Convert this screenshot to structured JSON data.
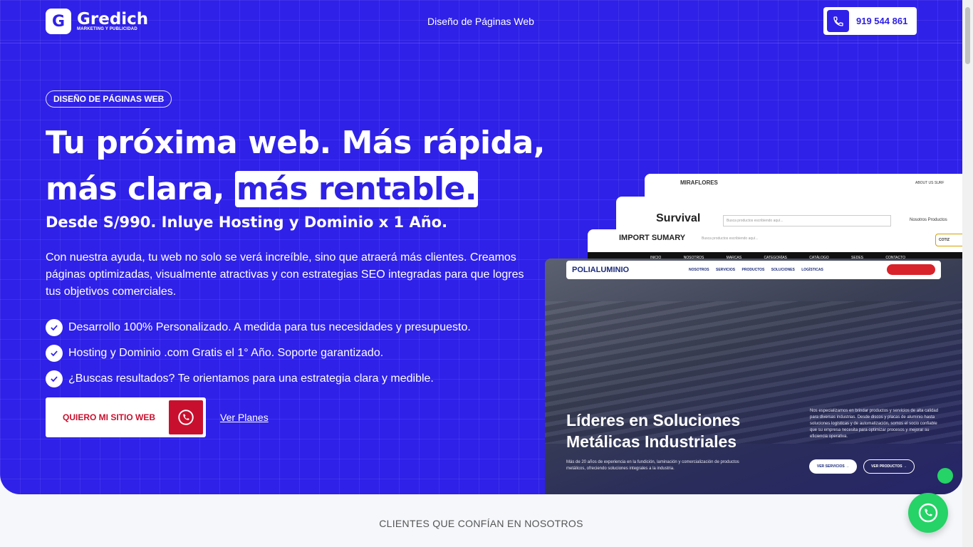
{
  "header": {
    "logo_mark": "G",
    "brand_name": "Gredich",
    "brand_tagline": "MARKETING Y PUBLICIDAD",
    "nav_title": "Diseño de Páginas Web",
    "phone": "919 544 861"
  },
  "hero": {
    "tag": "DISEÑO DE PÁGINAS WEB",
    "headline_part1": "Tu próxima web. Más rápida, más clara, ",
    "headline_highlight": "más rentable.",
    "subheadline": "Desde S/990. Inluye Hosting y Dominio x 1 Año.",
    "description": "Con nuestra ayuda, tu web no solo se verá increíble, sino que atraerá más clientes. Creamos páginas optimizadas, visualmente atractivas y con estrategias SEO integradas para que logres tus objetivos comerciales.",
    "checks": [
      "Desarrollo 100% Personalizado. A medida para tus necesidades y presupuesto.",
      "Hosting y Dominio .com Gratis el 1° Año. Soporte garantizado.",
      "¿Buscas resultados? Te orientamos para una estrategia clara y medible."
    ],
    "cta_label": "QUIERO MI SITIO WEB",
    "secondary_link": "Ver Planes"
  },
  "mockups": {
    "miraflores": {
      "logo": "MIRAFLORES",
      "links": "ABOUT US SURF"
    },
    "survival": {
      "logo": "Survival",
      "search": "Busca productos escribiendo aquí...",
      "links": "Nosotros Productos"
    },
    "import": {
      "logo": "IMPORT SUMARY",
      "search": "Busca productos escribiendo aquí...",
      "button": "COTIZ",
      "menu": "INICIO NOSOTROS MARCAS CATEGORÍAS CATÁLOGO SEDES CONTACTO"
    },
    "polialuminio": {
      "logo": "POLIALUMINIO",
      "links": "NOSOTROS SERVICIOS PRODUCTOS SOLUCIONES LOGÍSTICAS",
      "title_line1": "Líderes en Soluciones",
      "title_line2": "Metálicas Industriales",
      "small_text": "Más de 20 años de experiencia en la fundición, laminación y comercialización de productos metálicos, ofreciendo soluciones integrales a la industria.",
      "right_text": "Nos especializamos en brindar productos y servicios de alta calidad para diversas industrias. Desde discos y placas de aluminio hasta soluciones logísticas y de automatización, somos el socio confiable que su empresa necesita para optimizar procesos y mejorar su eficiencia operativa.",
      "btn1": "VER SERVICIOS →",
      "btn2": "VER PRODUCTOS →"
    }
  },
  "clients_title": "CLIENTES QUE CONFÍAN EN NOSOTROS",
  "colors": {
    "primary": "#2f21e8",
    "cta_red": "#c8102e",
    "whatsapp": "#25d366"
  }
}
